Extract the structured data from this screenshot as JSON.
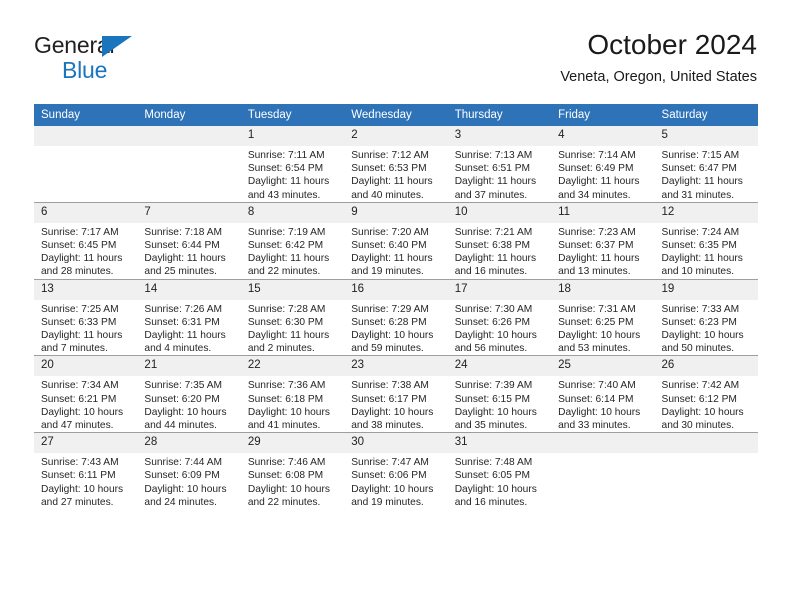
{
  "brand": {
    "name_top": "General",
    "name_bottom": "Blue",
    "triangle_color": "#1b75bc"
  },
  "header": {
    "title": "October 2024",
    "location": "Veneta, Oregon, United States"
  },
  "theme": {
    "header_blue": "#2e73b8",
    "daynum_band": "#f0f0f0",
    "grid_line": "#9e9e9e"
  },
  "calendar": {
    "weekday_headers": [
      "Sunday",
      "Monday",
      "Tuesday",
      "Wednesday",
      "Thursday",
      "Friday",
      "Saturday"
    ],
    "labels": {
      "sunrise": "Sunrise:",
      "sunset": "Sunset:",
      "daylight": "Daylight:"
    },
    "weeks": [
      [
        {
          "day": "",
          "empty": true
        },
        {
          "day": "",
          "empty": true
        },
        {
          "day": "1",
          "sunrise": "Sunrise: 7:11 AM",
          "sunset": "Sunset: 6:54 PM",
          "daylight": "Daylight: 11 hours and 43 minutes."
        },
        {
          "day": "2",
          "sunrise": "Sunrise: 7:12 AM",
          "sunset": "Sunset: 6:53 PM",
          "daylight": "Daylight: 11 hours and 40 minutes."
        },
        {
          "day": "3",
          "sunrise": "Sunrise: 7:13 AM",
          "sunset": "Sunset: 6:51 PM",
          "daylight": "Daylight: 11 hours and 37 minutes."
        },
        {
          "day": "4",
          "sunrise": "Sunrise: 7:14 AM",
          "sunset": "Sunset: 6:49 PM",
          "daylight": "Daylight: 11 hours and 34 minutes."
        },
        {
          "day": "5",
          "sunrise": "Sunrise: 7:15 AM",
          "sunset": "Sunset: 6:47 PM",
          "daylight": "Daylight: 11 hours and 31 minutes."
        }
      ],
      [
        {
          "day": "6",
          "sunrise": "Sunrise: 7:17 AM",
          "sunset": "Sunset: 6:45 PM",
          "daylight": "Daylight: 11 hours and 28 minutes."
        },
        {
          "day": "7",
          "sunrise": "Sunrise: 7:18 AM",
          "sunset": "Sunset: 6:44 PM",
          "daylight": "Daylight: 11 hours and 25 minutes."
        },
        {
          "day": "8",
          "sunrise": "Sunrise: 7:19 AM",
          "sunset": "Sunset: 6:42 PM",
          "daylight": "Daylight: 11 hours and 22 minutes."
        },
        {
          "day": "9",
          "sunrise": "Sunrise: 7:20 AM",
          "sunset": "Sunset: 6:40 PM",
          "daylight": "Daylight: 11 hours and 19 minutes."
        },
        {
          "day": "10",
          "sunrise": "Sunrise: 7:21 AM",
          "sunset": "Sunset: 6:38 PM",
          "daylight": "Daylight: 11 hours and 16 minutes."
        },
        {
          "day": "11",
          "sunrise": "Sunrise: 7:23 AM",
          "sunset": "Sunset: 6:37 PM",
          "daylight": "Daylight: 11 hours and 13 minutes."
        },
        {
          "day": "12",
          "sunrise": "Sunrise: 7:24 AM",
          "sunset": "Sunset: 6:35 PM",
          "daylight": "Daylight: 11 hours and 10 minutes."
        }
      ],
      [
        {
          "day": "13",
          "sunrise": "Sunrise: 7:25 AM",
          "sunset": "Sunset: 6:33 PM",
          "daylight": "Daylight: 11 hours and 7 minutes."
        },
        {
          "day": "14",
          "sunrise": "Sunrise: 7:26 AM",
          "sunset": "Sunset: 6:31 PM",
          "daylight": "Daylight: 11 hours and 4 minutes."
        },
        {
          "day": "15",
          "sunrise": "Sunrise: 7:28 AM",
          "sunset": "Sunset: 6:30 PM",
          "daylight": "Daylight: 11 hours and 2 minutes."
        },
        {
          "day": "16",
          "sunrise": "Sunrise: 7:29 AM",
          "sunset": "Sunset: 6:28 PM",
          "daylight": "Daylight: 10 hours and 59 minutes."
        },
        {
          "day": "17",
          "sunrise": "Sunrise: 7:30 AM",
          "sunset": "Sunset: 6:26 PM",
          "daylight": "Daylight: 10 hours and 56 minutes."
        },
        {
          "day": "18",
          "sunrise": "Sunrise: 7:31 AM",
          "sunset": "Sunset: 6:25 PM",
          "daylight": "Daylight: 10 hours and 53 minutes."
        },
        {
          "day": "19",
          "sunrise": "Sunrise: 7:33 AM",
          "sunset": "Sunset: 6:23 PM",
          "daylight": "Daylight: 10 hours and 50 minutes."
        }
      ],
      [
        {
          "day": "20",
          "sunrise": "Sunrise: 7:34 AM",
          "sunset": "Sunset: 6:21 PM",
          "daylight": "Daylight: 10 hours and 47 minutes."
        },
        {
          "day": "21",
          "sunrise": "Sunrise: 7:35 AM",
          "sunset": "Sunset: 6:20 PM",
          "daylight": "Daylight: 10 hours and 44 minutes."
        },
        {
          "day": "22",
          "sunrise": "Sunrise: 7:36 AM",
          "sunset": "Sunset: 6:18 PM",
          "daylight": "Daylight: 10 hours and 41 minutes."
        },
        {
          "day": "23",
          "sunrise": "Sunrise: 7:38 AM",
          "sunset": "Sunset: 6:17 PM",
          "daylight": "Daylight: 10 hours and 38 minutes."
        },
        {
          "day": "24",
          "sunrise": "Sunrise: 7:39 AM",
          "sunset": "Sunset: 6:15 PM",
          "daylight": "Daylight: 10 hours and 35 minutes."
        },
        {
          "day": "25",
          "sunrise": "Sunrise: 7:40 AM",
          "sunset": "Sunset: 6:14 PM",
          "daylight": "Daylight: 10 hours and 33 minutes."
        },
        {
          "day": "26",
          "sunrise": "Sunrise: 7:42 AM",
          "sunset": "Sunset: 6:12 PM",
          "daylight": "Daylight: 10 hours and 30 minutes."
        }
      ],
      [
        {
          "day": "27",
          "sunrise": "Sunrise: 7:43 AM",
          "sunset": "Sunset: 6:11 PM",
          "daylight": "Daylight: 10 hours and 27 minutes."
        },
        {
          "day": "28",
          "sunrise": "Sunrise: 7:44 AM",
          "sunset": "Sunset: 6:09 PM",
          "daylight": "Daylight: 10 hours and 24 minutes."
        },
        {
          "day": "29",
          "sunrise": "Sunrise: 7:46 AM",
          "sunset": "Sunset: 6:08 PM",
          "daylight": "Daylight: 10 hours and 22 minutes."
        },
        {
          "day": "30",
          "sunrise": "Sunrise: 7:47 AM",
          "sunset": "Sunset: 6:06 PM",
          "daylight": "Daylight: 10 hours and 19 minutes."
        },
        {
          "day": "31",
          "sunrise": "Sunrise: 7:48 AM",
          "sunset": "Sunset: 6:05 PM",
          "daylight": "Daylight: 10 hours and 16 minutes."
        },
        {
          "day": "",
          "empty": true
        },
        {
          "day": "",
          "empty": true
        }
      ]
    ]
  }
}
